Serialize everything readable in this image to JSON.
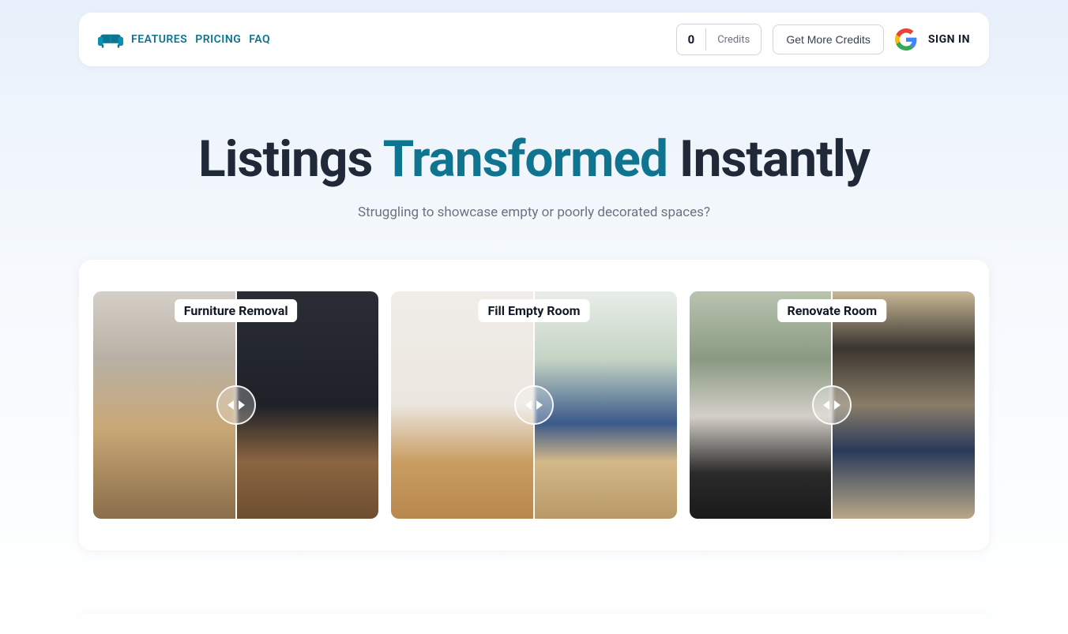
{
  "nav": {
    "links": {
      "features": "FEATURES",
      "pricing": "PRICING",
      "faq": "FAQ"
    },
    "credits": {
      "count": "0",
      "label": "Credits"
    },
    "get_credits_label": "Get More Credits",
    "sign_in_label": "SIGN IN"
  },
  "hero": {
    "title_part1": "Listings ",
    "title_accent": "Transformed",
    "title_part2": " Instantly",
    "subtitle": "Struggling to showcase empty or poorly decorated spaces?"
  },
  "cards": [
    {
      "label": "Furniture Removal"
    },
    {
      "label": "Fill Empty Room"
    },
    {
      "label": "Renovate Room"
    }
  ],
  "colors": {
    "accent": "#0e7490"
  }
}
